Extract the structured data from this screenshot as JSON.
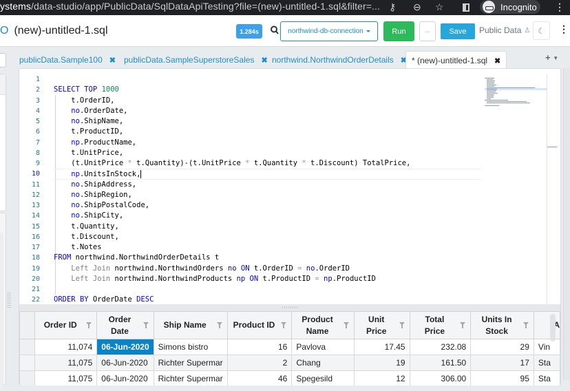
{
  "browser": {
    "url_host": "ystems",
    "url_path": "/data-studio/app/PublicData/SqlDataApiTesting?file=(new)-untitled-1.sql&filter=...",
    "key_icon": "key-icon",
    "zoom_icon": "zoom-out-icon",
    "star_icon": "star-icon",
    "incognito_label": "Incognito"
  },
  "header": {
    "file_title": "(new)-untitled-1.sql",
    "exec_time_badge": "1.284s",
    "connection": "northwind-db-connection",
    "run_label": "Run",
    "sync_label": "↔",
    "save_label": "Save",
    "workspace_label": "Public Data",
    "theme_icon": "☾",
    "more_icon": "⋮"
  },
  "tabs": [
    {
      "label": "publicData.Sample100",
      "active": false
    },
    {
      "label": "publicData.SampleSuperstoreSales",
      "active": false
    },
    {
      "label": "northwind.NorthwindOrderDetails",
      "active": false
    },
    {
      "label": "* (new)-untitled-1.sql",
      "active": true
    }
  ],
  "tab_add_label": "+",
  "editor": {
    "current_line": 10,
    "lines": [
      "",
      "SELECT TOP 1000",
      "    t.OrderID,",
      "    no.OrderDate,",
      "    no.ShipName,",
      "    t.ProductID,",
      "    np.ProductName,",
      "    t.UnitPrice,",
      "    (t.UnitPrice * t.Quantity)-(t.UnitPrice * t.Quantity * t.Discount) TotalPrice,",
      "    np.UnitsInStock,",
      "    no.ShipAddress,",
      "    no.ShipRegion,",
      "    no.ShipPostalCode,",
      "    no.ShipCity,",
      "    t.Quantity,",
      "    t.Discount,",
      "    t.Notes",
      "FROM northwind.NorthwindOrderDetails t",
      "    Left Join northwind.NorthwindOrders no ON t.OrderID = no.OrderID",
      "    Left Join northwind.NorthwindProducts np ON t.ProductID = np.ProductID",
      "",
      "ORDER BY OrderDate DESC"
    ]
  },
  "results": {
    "columns": [
      "Order ID",
      "Order Date",
      "Ship Name",
      "Product ID",
      "Product Name",
      "Unit Price",
      "Total Price",
      "Units In Stock",
      "A"
    ],
    "rows": [
      [
        "11,074",
        "06-Jun-2020",
        "Simons bistro",
        "16",
        "Pavlova",
        "17.45",
        "232.08",
        "29",
        "Vin"
      ],
      [
        "11,075",
        "06-Jun-2020",
        "Richter Supermar",
        "2",
        "Chang",
        "19",
        "161.50",
        "17",
        "Sta"
      ],
      [
        "11,075",
        "06-Jun-2020",
        "Richter Supermar",
        "46",
        "Spegesild",
        "12",
        "306.00",
        "95",
        "Sta"
      ]
    ],
    "selected_cell": {
      "row": 0,
      "col": 1
    }
  }
}
